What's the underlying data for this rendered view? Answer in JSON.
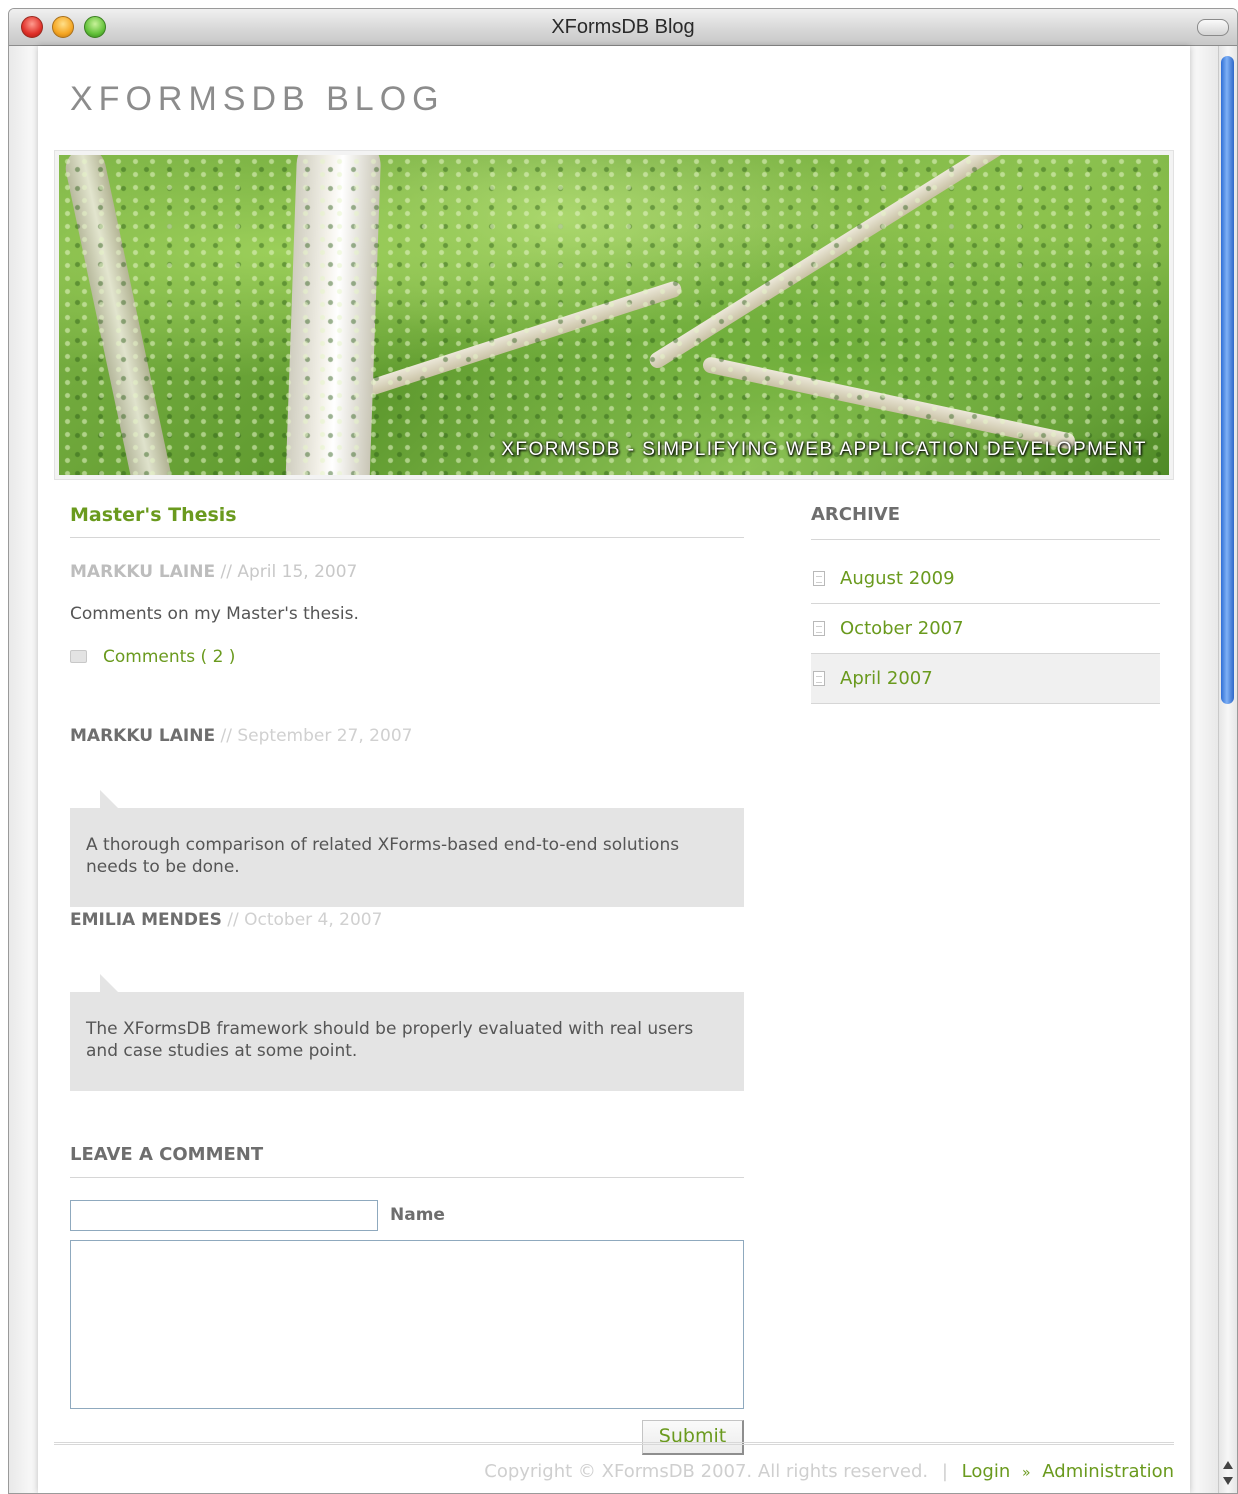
{
  "window": {
    "title": "XFormsDB Blog"
  },
  "site": {
    "title": "XFORMSDB BLOG",
    "banner_caption": "XFORMSDB - SIMPLIFYING WEB APPLICATION DEVELOPMENT"
  },
  "post": {
    "title": "Master's Thesis",
    "author": "MARKKU LAINE",
    "separator": "//",
    "date": "April 15, 2007",
    "body": "Comments on my Master's thesis.",
    "comments_link": "Comments ( 2 )"
  },
  "comments": [
    {
      "author": "MARKKU LAINE",
      "separator": "//",
      "date": "September 27, 2007",
      "text": "A thorough comparison of related XForms-based end-to-end solutions needs to be done."
    },
    {
      "author": "EMILIA MENDES",
      "separator": "//",
      "date": "October 4, 2007",
      "text": "The XFormsDB framework should be properly evaluated with real users and case studies at some point."
    }
  ],
  "comment_form": {
    "title": "LEAVE A COMMENT",
    "name_label": "Name",
    "name_value": "",
    "comment_value": "",
    "submit_label": "Submit"
  },
  "archive": {
    "title": "ARCHIVE",
    "items": [
      {
        "label": "August 2009"
      },
      {
        "label": "October 2007"
      },
      {
        "label": "April 2007",
        "active": true
      }
    ]
  },
  "footer": {
    "copyright": "Copyright © XFormsDB 2007. All rights reserved.",
    "separator": "|",
    "login": "Login",
    "arrow": "»",
    "admin": "Administration"
  },
  "colors": {
    "link_green": "#6a9a1e",
    "muted_gray": "#c8c8c8",
    "heading_gray": "#6e6e6e",
    "comment_bg": "#e4e4e4"
  }
}
